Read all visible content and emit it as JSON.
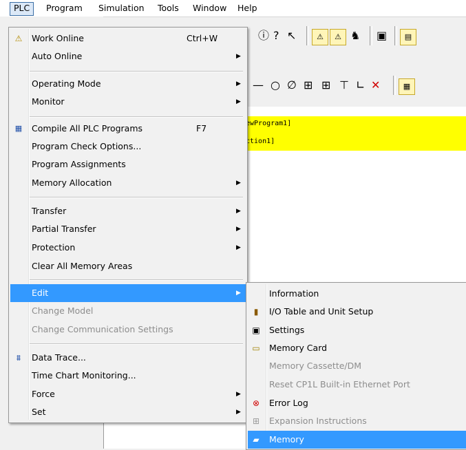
{
  "menubar": {
    "items": [
      "PLC",
      "Program",
      "Simulation",
      "Tools",
      "Window",
      "Help"
    ]
  },
  "editor": {
    "line1": "ewProgram1]",
    "line2": "ction1]"
  },
  "plc_menu": {
    "items": [
      {
        "label": "Work Online",
        "shortcut": "Ctrl+W",
        "icon": "warning-icon"
      },
      {
        "label": "Auto Online",
        "submenu": true
      },
      {
        "label": "Operating Mode",
        "submenu": true
      },
      {
        "label": "Monitor",
        "submenu": true
      },
      {
        "label": "Compile All PLC Programs",
        "shortcut": "F7",
        "icon": "compile-icon"
      },
      {
        "label": "Program Check Options..."
      },
      {
        "label": "Program Assignments"
      },
      {
        "label": "Memory Allocation",
        "submenu": true
      },
      {
        "label": "Transfer",
        "submenu": true
      },
      {
        "label": "Partial Transfer",
        "submenu": true
      },
      {
        "label": "Protection",
        "submenu": true
      },
      {
        "label": "Clear All Memory Areas"
      },
      {
        "label": "Edit",
        "submenu": true,
        "selected": true
      },
      {
        "label": "Change Model",
        "disabled": true
      },
      {
        "label": "Change Communication Settings",
        "disabled": true
      },
      {
        "label": "Data Trace...",
        "icon": "data-trace-icon"
      },
      {
        "label": "Time Chart Monitoring..."
      },
      {
        "label": "Force",
        "submenu": true
      },
      {
        "label": "Set",
        "submenu": true
      }
    ]
  },
  "edit_submenu": {
    "items": [
      {
        "label": "Information"
      },
      {
        "label": "I/O Table and Unit Setup",
        "icon": "io-table-icon"
      },
      {
        "label": "Settings",
        "icon": "settings-icon"
      },
      {
        "label": "Memory Card",
        "icon": "memory-card-icon"
      },
      {
        "label": "Memory Cassette/DM",
        "disabled": true
      },
      {
        "label": "Reset CP1L Built-in Ethernet Port",
        "disabled": true
      },
      {
        "label": "Error Log",
        "icon": "error-log-icon"
      },
      {
        "label": "Expansion Instructions",
        "disabled": true,
        "icon": "expansion-icon"
      },
      {
        "label": "Memory",
        "selected": true,
        "icon": "memory-icon"
      }
    ]
  },
  "colors": {
    "selection": "#3399ff",
    "menu_bg": "#f1f1f1",
    "disabled_text": "#8d8d8d",
    "ladder_highlight": "#ffff00"
  }
}
